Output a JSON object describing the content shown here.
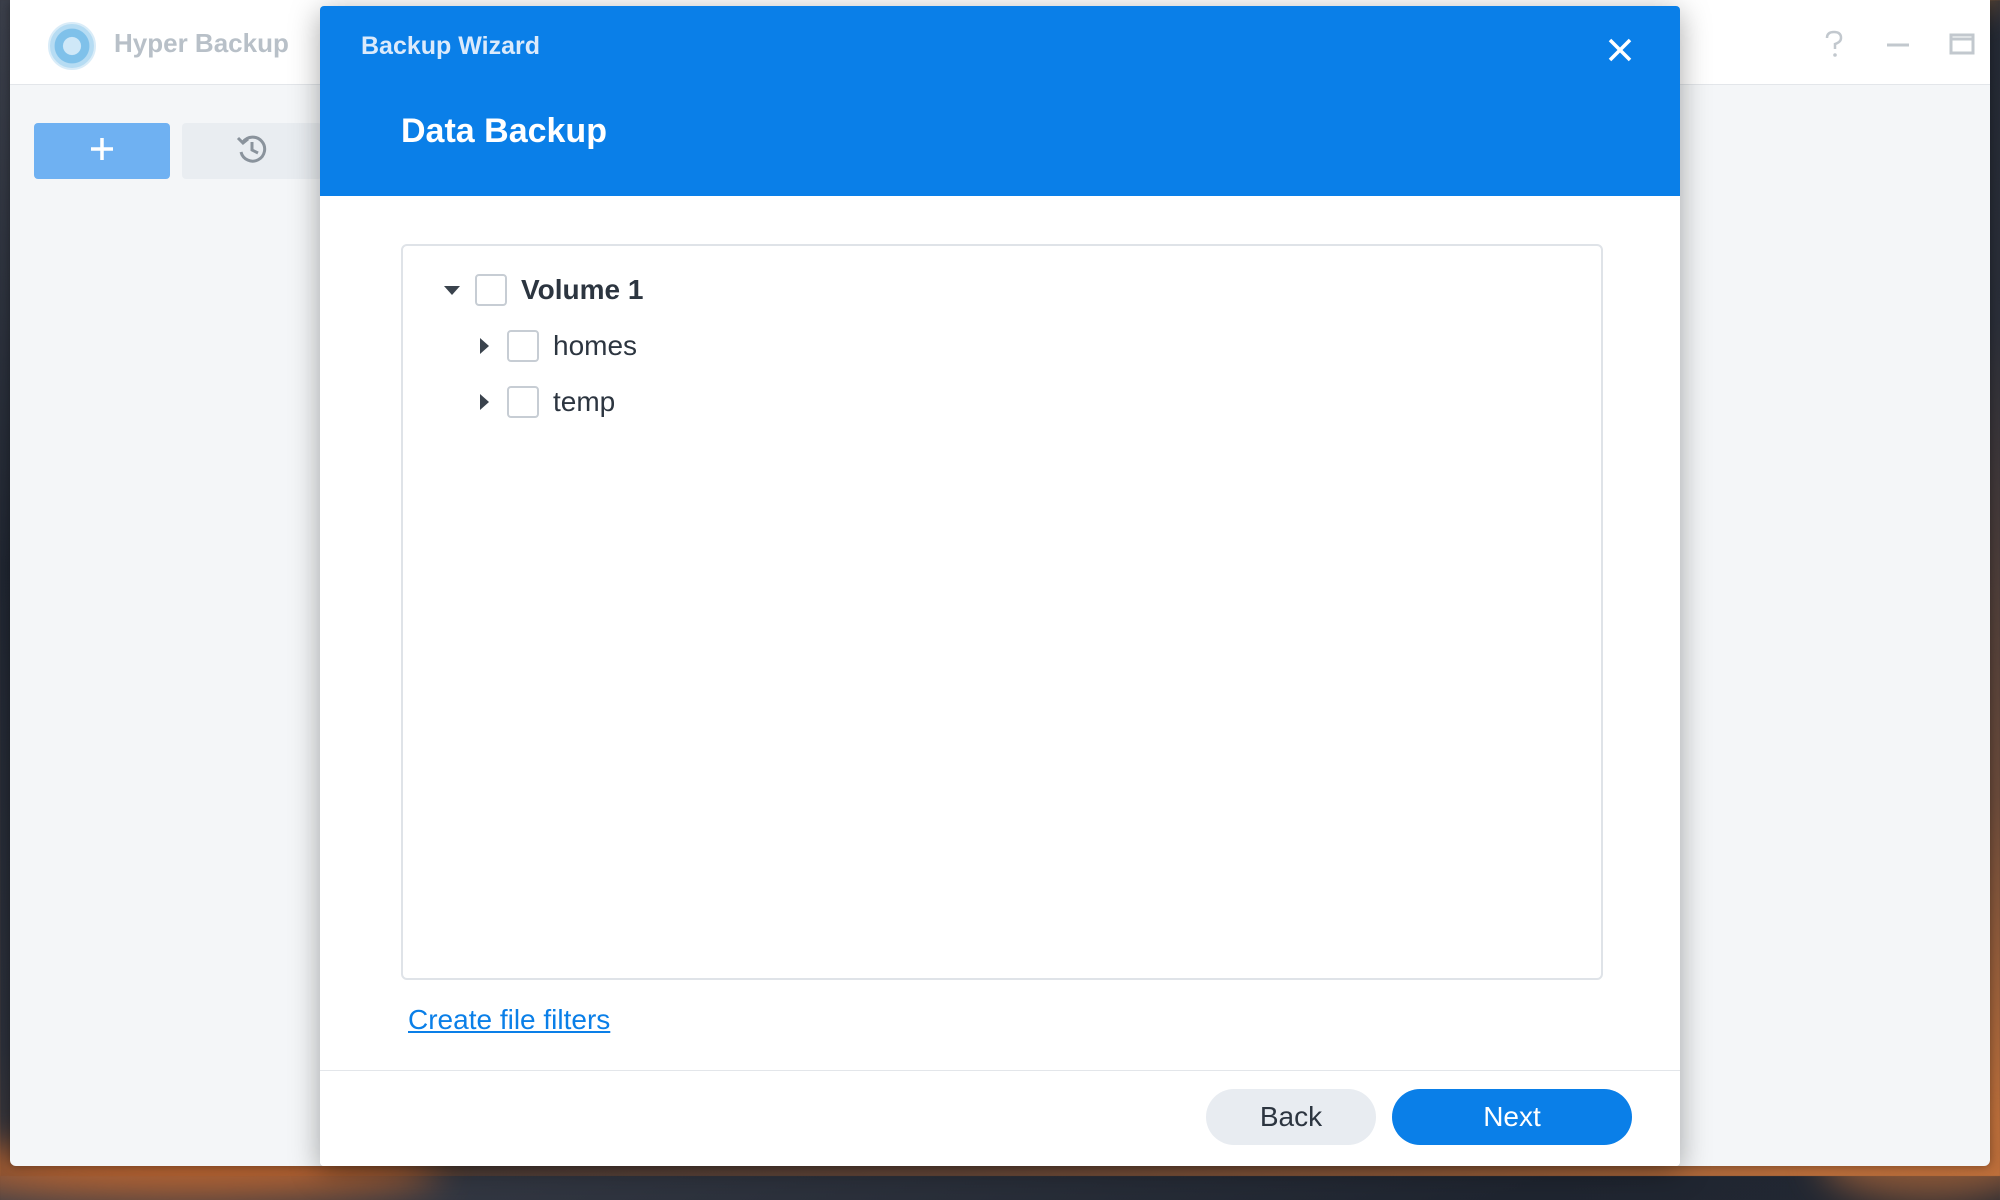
{
  "app": {
    "title": "Hyper Backup",
    "toolbar": {
      "add_icon": "plus-icon",
      "history_icon": "history-icon"
    },
    "window_controls": [
      "help-icon",
      "minimize-icon",
      "maximize-icon",
      "close-icon"
    ]
  },
  "wizard": {
    "title": "Backup Wizard",
    "step_title": "Data Backup",
    "tree": [
      {
        "label": "Volume 1",
        "expanded": true,
        "checked": false,
        "level": 0
      },
      {
        "label": "homes",
        "expanded": false,
        "checked": false,
        "level": 1
      },
      {
        "label": "temp",
        "expanded": false,
        "checked": false,
        "level": 1
      }
    ],
    "filter_link": "Create file filters",
    "buttons": {
      "back": "Back",
      "next": "Next"
    }
  },
  "colors": {
    "accent": "#0a7fe8",
    "header_bg": "#0a7fe8"
  }
}
